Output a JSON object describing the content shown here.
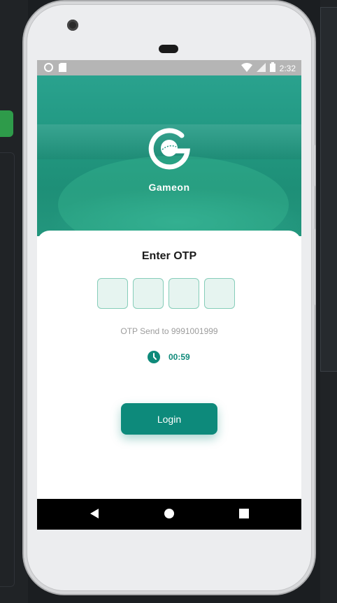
{
  "statusbar": {
    "time": "2:32"
  },
  "hero": {
    "brand": "Gameon"
  },
  "otp": {
    "title": "Enter OTP",
    "digits": [
      "",
      "",
      "",
      ""
    ],
    "sent_text": "OTP Send to 9991001999",
    "timer": "00:59"
  },
  "login_label": "Login",
  "colors": {
    "accent": "#0d8a7b",
    "hero": "#229983",
    "otp_border": "#86cdb9"
  },
  "icons": [
    "camera-icon",
    "sim-icon",
    "wifi-icon",
    "signal-icon",
    "battery-icon",
    "clock-icon",
    "back-icon",
    "home-icon",
    "recents-icon",
    "gameon-logo"
  ]
}
